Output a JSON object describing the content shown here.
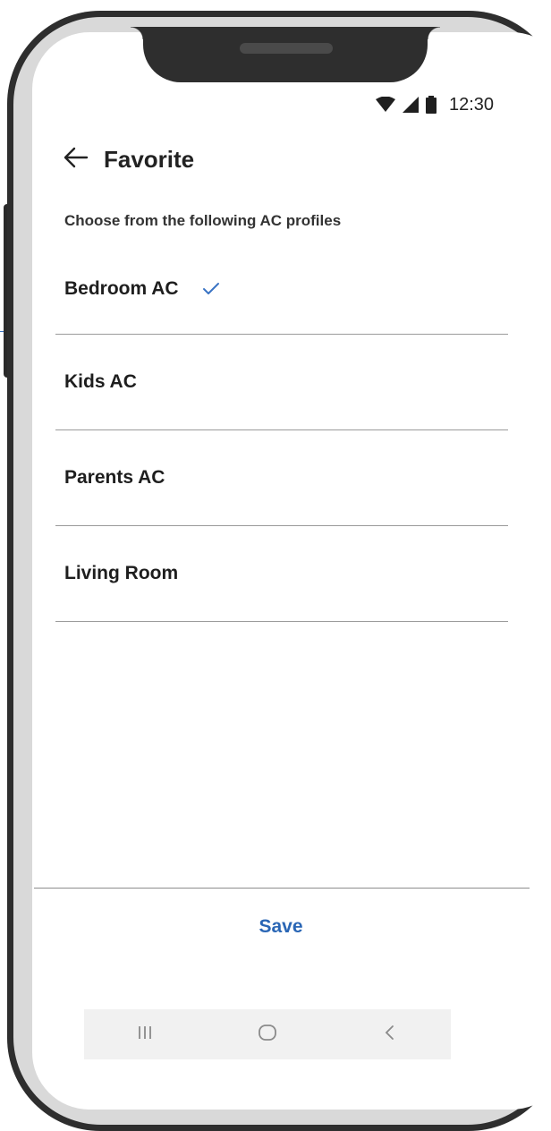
{
  "status_bar": {
    "time": "12:30",
    "icons": [
      "wifi-icon",
      "signal-icon",
      "battery-icon"
    ]
  },
  "header": {
    "back_icon": "arrow-left-icon",
    "title": "Favorite"
  },
  "subtitle": "Choose from the following AC profiles",
  "profiles": [
    {
      "label": "Bedroom AC",
      "selected": true
    },
    {
      "label": "Kids AC",
      "selected": false
    },
    {
      "label": "Parents AC",
      "selected": false
    },
    {
      "label": "Living Room",
      "selected": false
    }
  ],
  "footer": {
    "save_label": "Save"
  },
  "nav_bar": {
    "icons": [
      "recent-apps-icon",
      "home-icon",
      "back-icon"
    ]
  },
  "colors": {
    "accent": "#2a66b5",
    "check": "#3a74c4",
    "text": "#1e1e1e",
    "divider": "#9a9a9a"
  }
}
